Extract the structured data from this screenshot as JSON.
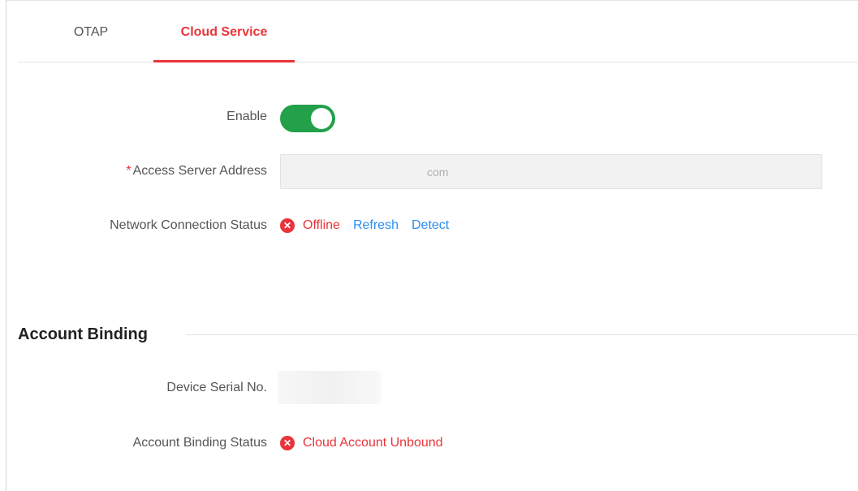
{
  "tabs": {
    "items": [
      {
        "label": "OTAP",
        "active": false
      },
      {
        "label": "Cloud Service",
        "active": true
      }
    ]
  },
  "form": {
    "enable": {
      "label": "Enable",
      "value": true
    },
    "server": {
      "required_mark": "*",
      "label": "Access Server Address",
      "value": "com"
    },
    "network": {
      "label": "Network Connection Status",
      "status": "Offline",
      "status_icon": "error-circle-icon",
      "refresh_label": "Refresh",
      "detect_label": "Detect"
    }
  },
  "account": {
    "title": "Account Binding",
    "serial": {
      "label": "Device Serial No.",
      "value": ""
    },
    "binding": {
      "label": "Account Binding Status",
      "status": "Cloud Account Unbound",
      "status_icon": "error-circle-icon"
    }
  },
  "colors": {
    "accent": "#e8343a",
    "link": "#2a8ef0",
    "toggle_on": "#23a04a"
  }
}
